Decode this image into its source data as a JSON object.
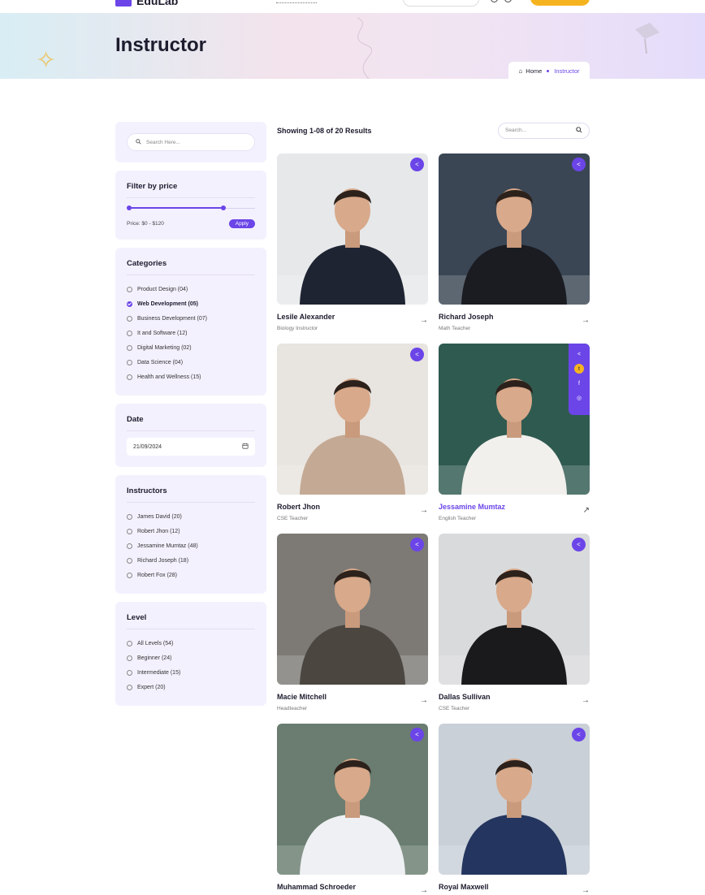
{
  "header": {
    "logo_text": "EduLab"
  },
  "hero": {
    "title": "Instructor",
    "breadcrumb_home": "Home",
    "breadcrumb_current": "Instructor"
  },
  "sidebar": {
    "search_placeholder": "Search Here...",
    "price": {
      "title": "Filter by price",
      "label": "Price: $0 - $120",
      "apply_label": "Apply",
      "range_min_fraction": 0.0,
      "range_max_fraction": 0.75
    },
    "categories": {
      "title": "Categories",
      "items": [
        {
          "label": "Product Design (04)",
          "checked": false
        },
        {
          "label": "Web Development (05)",
          "checked": true
        },
        {
          "label": "Business Development (07)",
          "checked": false
        },
        {
          "label": "It and Software (12)",
          "checked": false
        },
        {
          "label": "Digital Marketing (02)",
          "checked": false
        },
        {
          "label": "Data Science (04)",
          "checked": false
        },
        {
          "label": "Health and Wellness (15)",
          "checked": false
        }
      ]
    },
    "date": {
      "title": "Date",
      "value": "21/09/2024"
    },
    "instructors": {
      "title": "Instructors",
      "items": [
        {
          "label": "James David (20)"
        },
        {
          "label": "Robert Jhon (12)"
        },
        {
          "label": "Jessamine Mumtaz (48)"
        },
        {
          "label": "Richard Joseph (18)"
        },
        {
          "label": "Robert Fox (28)"
        }
      ]
    },
    "level": {
      "title": "Level",
      "items": [
        {
          "label": "All Levels (54)"
        },
        {
          "label": "Beginner (24)"
        },
        {
          "label": "Intermediate (15)"
        },
        {
          "label": "Expert (20)"
        }
      ]
    }
  },
  "main": {
    "results_text": "Showing 1-08 of 20 Results",
    "search_placeholder": "Search...",
    "instructors": [
      {
        "name": "Lesile Alexander",
        "role": "Biology Instructor",
        "bg": "#e6e8ea",
        "suit": "#1f2433"
      },
      {
        "name": "Richard Joseph",
        "role": "Math Teacher",
        "bg": "#3a4654",
        "suit": "#1b1c22"
      },
      {
        "name": "Robert Jhon",
        "role": "CSE Teacher",
        "bg": "#e8e4df",
        "suit": "#c4a994"
      },
      {
        "name": "Jessamine Mumtaz",
        "role": "English Teacher",
        "bg": "#2f5a50",
        "suit": "#f1f0ed"
      },
      {
        "name": "Macie Mitchell",
        "role": "Headteacher",
        "bg": "#7d7a76",
        "suit": "#4b4640"
      },
      {
        "name": "Dallas Sullivan",
        "role": "CSE Teacher",
        "bg": "#d9dadc",
        "suit": "#1a1a1c"
      },
      {
        "name": "Muhammad Schroeder",
        "role": "",
        "bg": "#6a7d70",
        "suit": "#eef0f3"
      },
      {
        "name": "Royal Maxwell",
        "role": "",
        "bg": "#c9d0d8",
        "suit": "#24365f"
      }
    ]
  },
  "colors": {
    "accent": "#6b45e8",
    "yellow": "#f5b41f",
    "panel": "#f4f1fe"
  },
  "icons": {
    "share": "share-icon",
    "arrow": "arrow-right-icon",
    "search": "search-icon",
    "calendar": "calendar-icon"
  }
}
